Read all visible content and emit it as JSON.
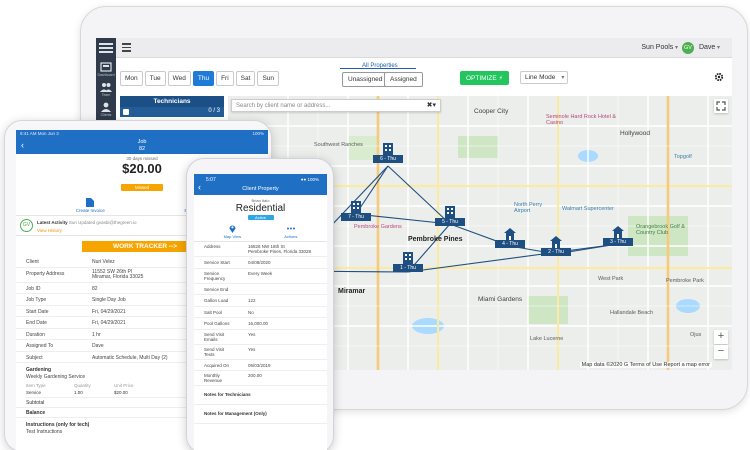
{
  "desktop": {
    "sidebar": {
      "items": [
        {
          "label": "Dashboard",
          "icon": "dashboard-icon"
        },
        {
          "label": "Team",
          "icon": "team-icon"
        },
        {
          "label": "Clients",
          "icon": "clients-icon"
        }
      ]
    },
    "topbar": {
      "company": "Sun Pools",
      "user_initials": "GV",
      "user_name": "Dave"
    },
    "toolbar": {
      "days": [
        "Mon",
        "Tue",
        "Wed",
        "Thu",
        "Fri",
        "Sat",
        "Sun"
      ],
      "active_day": "Thu",
      "all_properties": "All Properties",
      "unassigned": "Unassigned",
      "assigned": "Assigned",
      "optimize": "OPTIMIZE ⚡",
      "line_mode": "Line Mode"
    },
    "technicians": {
      "title": "Technicians",
      "count": "0 / 3"
    },
    "map": {
      "search_placeholder": "Search by client name or address...",
      "footer": "Map data ©2020 G  Terms of Use  Report a map error",
      "zoom_in": "+",
      "zoom_out": "−",
      "labels": {
        "cooper_city": "Cooper City",
        "southwest_ranches": "Southwest Ranches",
        "seminole": "Seminole Hard Rock Hotel & Casino",
        "hollywood": "Hollywood",
        "topgolf": "Topgolf",
        "pembroke_pines": "Pembroke Pines",
        "pembroke_gardens": "Pembroke Gardens",
        "north_perry": "North Perry Airport",
        "miramar_tire": "Walmart Supercenter",
        "orangebrook": "Orangebrook Golf & Country Club",
        "miramar": "Miramar",
        "pembroke_park": "Pembroke Park",
        "west_park": "West Park",
        "miami_gardens": "Miami Gardens",
        "lake_lucerne": "Lake Lucerne",
        "ojus": "Ojus",
        "hallandale": "Hallandale Beach"
      },
      "stops": [
        {
          "label": "6 - Thu",
          "icon": "building"
        },
        {
          "label": "7 - Thu",
          "icon": "building"
        },
        {
          "label": "5 - Thu",
          "icon": "building"
        },
        {
          "label": "4 - Thu",
          "icon": "house"
        },
        {
          "label": "2 - Thu",
          "icon": "house"
        },
        {
          "label": "3 - Thu",
          "icon": "house"
        },
        {
          "label": "1 - Thu",
          "icon": "building"
        }
      ]
    }
  },
  "tablet": {
    "status_left": "9:41 AM  Mon Jun 3",
    "status_right": "100%",
    "header_title": "Job",
    "header_id": "82",
    "days_info": "30 days missed",
    "price": "$20.00",
    "badge": "Missed",
    "actions": [
      {
        "label": "Create Invoice",
        "icon": "document-icon"
      },
      {
        "label": "Send Quote",
        "icon": "send-icon"
      }
    ],
    "activity": {
      "initials": "GV",
      "title": "Latest Activity",
      "subtitle": "Sun Updated gvasbi@thegreen.io",
      "link": "View History"
    },
    "tracker": "WORK TRACKER -->",
    "rows": [
      {
        "k": "Client",
        "v": "Nuri Velez"
      },
      {
        "k": "Property Address",
        "v": "11552 SW 26th Pl",
        "v2": "Miramar, Florida 33025"
      },
      {
        "k": "Job ID",
        "v": "82"
      },
      {
        "k": "Job Type",
        "v": "Single Day Job"
      },
      {
        "k": "Start Date",
        "v": "Fri, 04/29/2021"
      },
      {
        "k": "End Date",
        "v": "Fri, 04/29/2021"
      },
      {
        "k": "Duration",
        "v": "1 hr"
      },
      {
        "k": "Assigned To",
        "v": "Dave"
      },
      {
        "k": "Subject",
        "v": "Automatic Schedule, Multi Day (2)"
      }
    ],
    "gardening": {
      "title": "Gardening",
      "service": "Weekly Gardening Service",
      "headers": [
        "Item Type",
        "Quantity",
        "Unit Price"
      ],
      "values": [
        "Service",
        "1.00",
        "$20.00"
      ]
    },
    "subtotal": "Subtotal",
    "balance": "Balance",
    "instructions_title": "Instructions (only for tech)",
    "instructions": "Test Instructions"
  },
  "phone": {
    "time": "5:07",
    "status_right": "●● 100%",
    "title": "Client Property",
    "owner": "Brian Italo",
    "type": "Residential",
    "badge": "Active",
    "actions": [
      {
        "label": "Map View",
        "icon": "map-pin-icon"
      },
      {
        "label": "Actions",
        "icon": "more-icon"
      }
    ],
    "rows": [
      {
        "k": "Address",
        "v": "16826 NW 18th St",
        "v2": "Pembroke Pines, Florida 33028",
        "tall": true
      },
      {
        "k": "Service Start",
        "v": "04/08/2020"
      },
      {
        "k": "Service",
        "k2": "Frequency",
        "v": "Every Week",
        "tall": true
      },
      {
        "k": "Service End",
        "v": ""
      },
      {
        "k": "Gallon Load",
        "v": "122"
      },
      {
        "k": "Salt Pool",
        "v": "No"
      },
      {
        "k": "Pool Gallons",
        "v": "16,000.00"
      },
      {
        "k": "Send Visit",
        "k2": "Emails",
        "v": "Yes",
        "tall": true
      },
      {
        "k": "Send Visit",
        "k2": "Texts",
        "v": "Yes",
        "tall": true
      },
      {
        "k": "Acquired On",
        "v": "05/03/2019"
      },
      {
        "k": "Monthly",
        "k2": "Revenue",
        "v": "200.00",
        "tall": true
      }
    ],
    "notes_tech": "Notes for Technicians",
    "notes_mgmt": "Notes for Management (Only)"
  }
}
